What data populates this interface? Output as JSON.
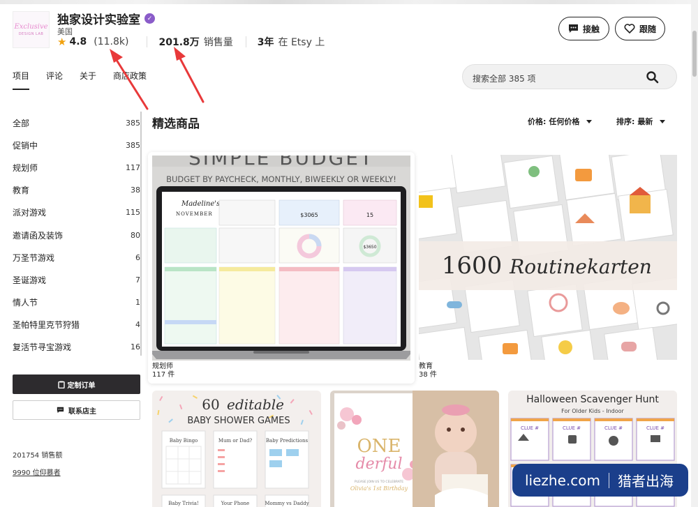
{
  "shop": {
    "name": "独家设计实验室",
    "logo_line1": "Exclusive",
    "logo_line2": "DESIGN LAB",
    "location": "美国",
    "rating": "4.8",
    "reviews": "(11.8k)",
    "sales_value": "201.8万",
    "sales_label": "销售量",
    "years_value": "3年",
    "years_label": "在 Etsy 上"
  },
  "header_buttons": {
    "contact": "接触",
    "follow": "跟随"
  },
  "tabs": [
    "项目",
    "评论",
    "关于",
    "商店政策"
  ],
  "search": {
    "placeholder": "搜索全部 385 项"
  },
  "sidebar": {
    "categories": [
      {
        "label": "全部",
        "count": "385"
      },
      {
        "label": "促销中",
        "count": "385"
      },
      {
        "label": "规划师",
        "count": "117"
      },
      {
        "label": "教育",
        "count": "38"
      },
      {
        "label": "派对游戏",
        "count": "115"
      },
      {
        "label": "邀请函及装饰",
        "count": "80"
      },
      {
        "label": "万圣节游戏",
        "count": "6"
      },
      {
        "label": "圣诞游戏",
        "count": "7"
      },
      {
        "label": "情人节",
        "count": "1"
      },
      {
        "label": "圣帕特里克节狩猎",
        "count": "4"
      },
      {
        "label": "复活节寻宝游戏",
        "count": "16"
      }
    ],
    "custom_order": "定制订单",
    "contact_owner": "联系店主",
    "sales_count": "201754 销售额",
    "admirers": "9990 位仰慕者"
  },
  "main": {
    "section_title": "精选商品",
    "price_filter_label": "价格:",
    "price_filter_value": "任何价格",
    "sort_label": "排序:",
    "sort_value": "最新"
  },
  "featured": [
    {
      "name": "规划师",
      "count": "117 件",
      "img_title": "SIMPLE BUDGET",
      "img_subtitle": "BUDGET BY PAYCHECK, MONTHLY, BIWEEKLY OR WEEKLY!",
      "sheet_name": "Madeline's",
      "sheet_month": "NOVEMBER",
      "sheet_left": "$3065",
      "sheet_days": "15",
      "sheet_donut": "$3650"
    },
    {
      "name": "教育",
      "count": "38 件",
      "img_title_num": "1600",
      "img_title_word": "Routinekarten"
    }
  ],
  "products": [
    {
      "title_num": "60",
      "title_word": "editable",
      "title_line2": "BABY SHOWER GAMES",
      "cards": [
        "Baby Bingo",
        "Mum or Dad?",
        "Baby Predictions",
        "Baby Trivia!",
        "Your Phone",
        "Mommy vs Daddy"
      ]
    },
    {
      "line1": "ONE",
      "line2": "derful",
      "invite_top": "PLEASE JOIN US TO CELEBRATE",
      "invite_name": "Olivia's 1st Birthday"
    },
    {
      "title": "Halloween Scavenger Hunt",
      "subtitle": "For Older Kids - Indoor",
      "clue": "CLUE #"
    }
  ],
  "watermark": {
    "site": "liezhe.com",
    "name": "猎者出海"
  },
  "colors": {
    "annotation": "#e8393a",
    "verified": "#8a5cc9",
    "star": "#f1a10e",
    "dark_button": "#2d2b2e",
    "watermark_bg": "#1b3f8b"
  }
}
